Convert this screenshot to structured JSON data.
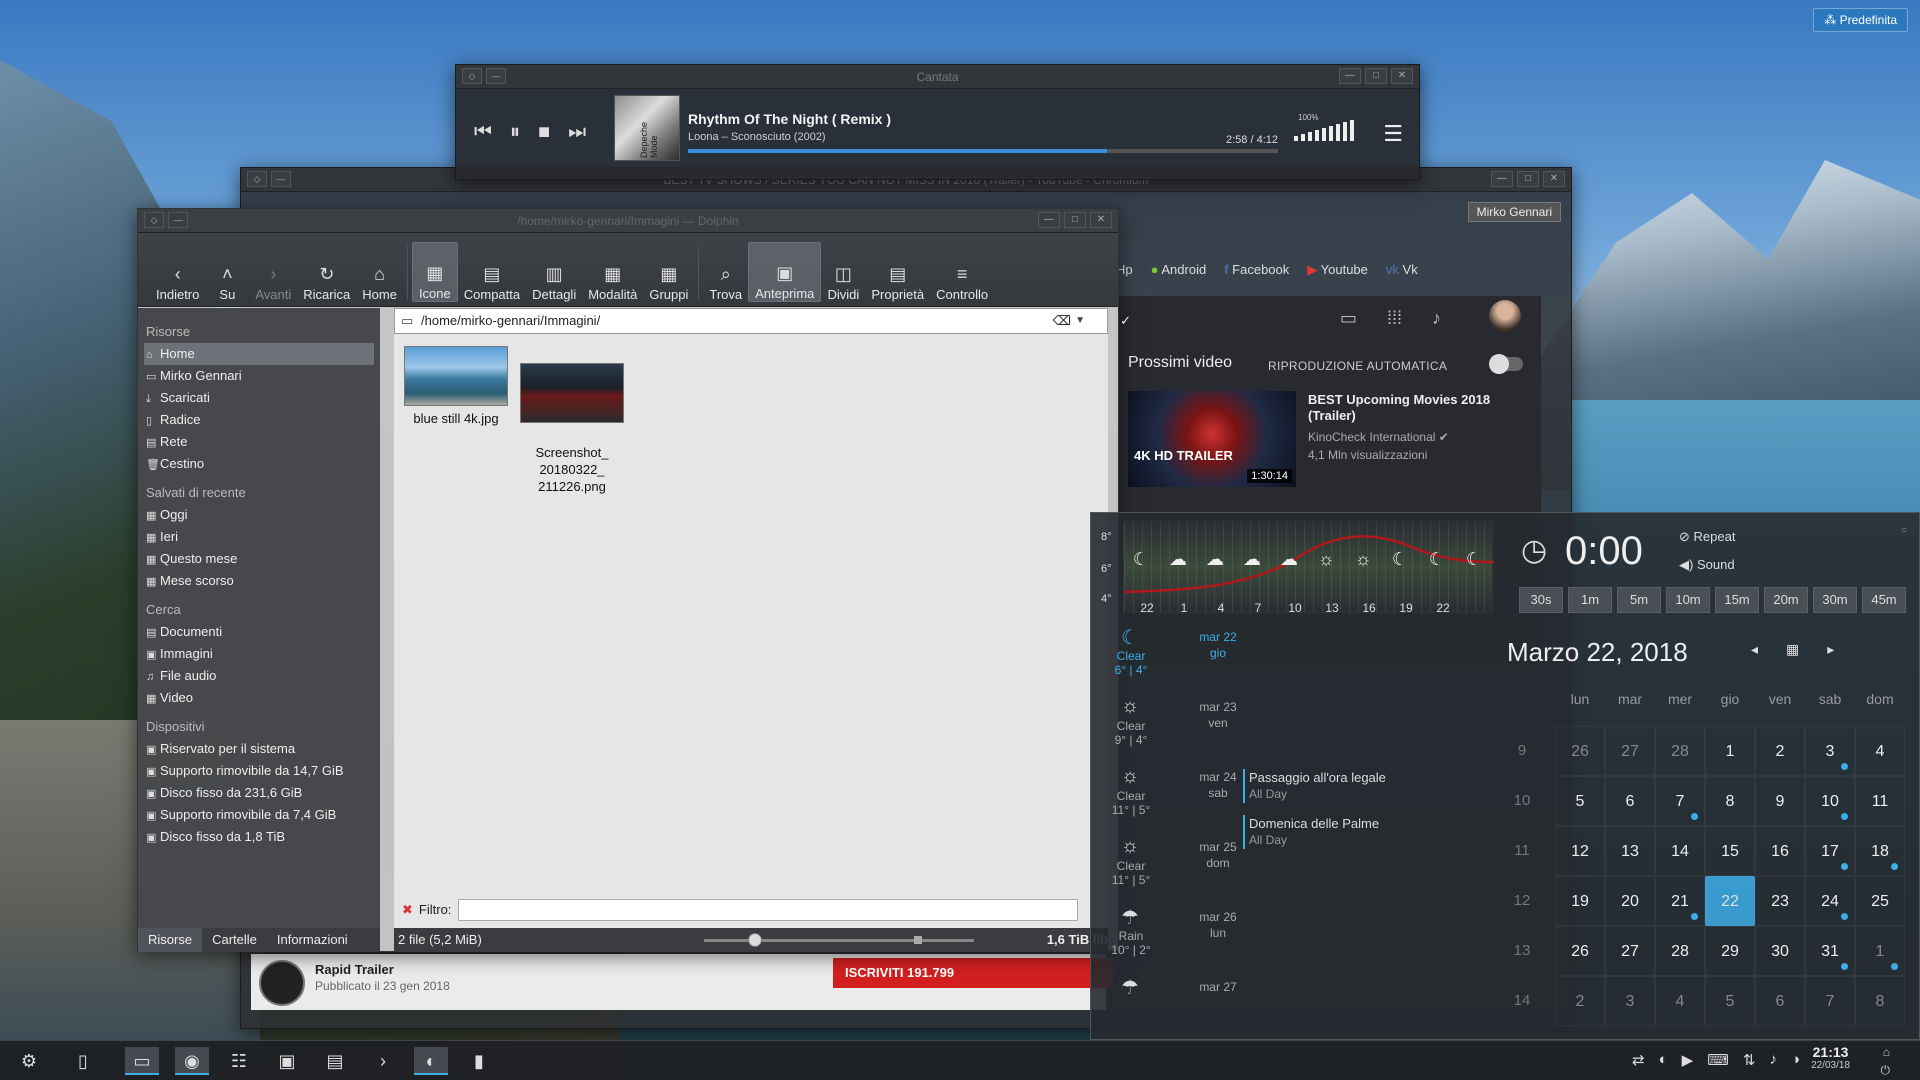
{
  "desktop": {
    "activity_label": "Predefinita"
  },
  "cantata": {
    "title": "Cantata",
    "track_title": "Rhythm Of The Night  ( Remix )",
    "track_subtitle": "Loona – Sconosciuto (2002)",
    "cover_text": "Depeche Mode",
    "time": "2:58 / 4:12",
    "progress": 0.71,
    "volume_label": "100%",
    "controls": [
      "⏮",
      "⏸",
      "■",
      "⏭"
    ]
  },
  "chromium": {
    "title": "BEST TV SHOWS / SERIES YOU CAN NOT MISS IN 2018 (Trailer) - YouTube - Chromium",
    "user": "Mirko Gennari",
    "bookmarks": [
      "Hp",
      "Android",
      "Facebook",
      "Youtube",
      "Vk"
    ],
    "up_next_label": "Prossimi video",
    "autoplay_label": "RIPRODUZIONE AUTOMATICA",
    "video": {
      "title": "BEST Upcoming Movies 2018 (Trailer)",
      "channel": "KinoCheck International ✔",
      "views": "4,1 Mln visualizzazioni",
      "duration": "1:30:14",
      "badge": "4K HD TRAILER"
    },
    "channel_name": "Rapid Trailer",
    "channel_published": "Pubblicato il 23 gen 2018",
    "subscribe_label": "ISCRIVITI  191.799"
  },
  "dolphin": {
    "title": "/home/mirko-gennari/Immagini — Dolphin",
    "toolbar": [
      {
        "label": "Indietro",
        "icon": "‹",
        "dim": false,
        "active": false
      },
      {
        "label": "Su",
        "icon": "˄",
        "dim": false,
        "active": false
      },
      {
        "label": "Avanti",
        "icon": "›",
        "dim": true,
        "active": false
      },
      {
        "label": "Ricarica",
        "icon": "↻",
        "dim": false,
        "active": false
      },
      {
        "label": "Home",
        "icon": "⌂",
        "dim": false,
        "active": false
      },
      {
        "label": "Icone",
        "icon": "▦",
        "dim": false,
        "active": true
      },
      {
        "label": "Compatta",
        "icon": "▤",
        "dim": false,
        "active": false
      },
      {
        "label": "Dettagli",
        "icon": "▥",
        "dim": false,
        "active": false
      },
      {
        "label": "Modalità",
        "icon": "▦",
        "dim": false,
        "active": false
      },
      {
        "label": "Gruppi",
        "icon": "▦",
        "dim": false,
        "active": false
      },
      {
        "label": "Trova",
        "icon": "⌕",
        "dim": false,
        "active": false
      },
      {
        "label": "Anteprima",
        "icon": "▣",
        "dim": false,
        "active": true
      },
      {
        "label": "Dividi",
        "icon": "◫",
        "dim": false,
        "active": false
      },
      {
        "label": "Proprietà",
        "icon": "▤",
        "dim": false,
        "active": false
      },
      {
        "label": "Controllo",
        "icon": "≡",
        "dim": false,
        "active": false
      }
    ],
    "sidebar": {
      "groups": [
        {
          "title": "Risorse",
          "items": [
            {
              "label": "Home",
              "icon": "⌂",
              "selected": true
            },
            {
              "label": "Mirko Gennari",
              "icon": "▭"
            },
            {
              "label": "Scaricati",
              "icon": "⤓"
            },
            {
              "label": "Radice",
              "icon": "▯"
            },
            {
              "label": "Rete",
              "icon": "▤"
            },
            {
              "label": "Cestino",
              "icon": "🗑"
            }
          ]
        },
        {
          "title": "Salvati di recente",
          "items": [
            {
              "label": "Oggi",
              "icon": "▦"
            },
            {
              "label": "Ieri",
              "icon": "▦"
            },
            {
              "label": "Questo mese",
              "icon": "▦"
            },
            {
              "label": "Mese scorso",
              "icon": "▦"
            }
          ]
        },
        {
          "title": "Cerca",
          "items": [
            {
              "label": "Documenti",
              "icon": "▤"
            },
            {
              "label": "Immagini",
              "icon": "▣"
            },
            {
              "label": "File audio",
              "icon": "♫"
            },
            {
              "label": "Video",
              "icon": "▦"
            }
          ]
        },
        {
          "title": "Dispositivi",
          "items": [
            {
              "label": "Riservato per il sistema",
              "icon": "▣",
              "color": "orange"
            },
            {
              "label": "Supporto rimovibile da 14,7 GiB",
              "icon": "▣",
              "color": "green"
            },
            {
              "label": "Disco fisso da 231,6 GiB",
              "icon": "▣",
              "color": "orange"
            },
            {
              "label": "Supporto rimovibile da 7,4 GiB",
              "icon": "▣",
              "color": "orange"
            },
            {
              "label": "Disco fisso da 1,8 TiB",
              "icon": "▣",
              "color": "green"
            }
          ]
        }
      ],
      "tabs": [
        "Risorse",
        "Cartelle",
        "Informazioni"
      ]
    },
    "path": "/home/mirko-gennari/Immagini/",
    "files": [
      {
        "name": "blue still 4k.jpg"
      },
      {
        "name": "Screenshot_\n20180322_\n211226.png"
      }
    ],
    "filter_label": "Filtro:",
    "status": "2 file (5,2 MiB)",
    "free_space": "1,6 TiB lib"
  },
  "weather": {
    "temp_labels": [
      "8°",
      "6°",
      "4°"
    ],
    "hours": [
      "22",
      "1",
      "4",
      "7",
      "10",
      "13",
      "16",
      "19",
      "22"
    ],
    "hour_icons": [
      "☾",
      "☁",
      "☁",
      "☁",
      "☁",
      "☼",
      "☼",
      "☾",
      "☾",
      "☾"
    ],
    "days": [
      {
        "icon": "☾",
        "desc": "Clear",
        "temps": "6° | 4°",
        "date": "mar 22",
        "weekday": "gio",
        "current": true
      },
      {
        "icon": "☼",
        "desc": "Clear",
        "temps": "9° | 4°",
        "date": "mar 23",
        "weekday": "ven"
      },
      {
        "icon": "☼",
        "desc": "Clear",
        "temps": "11° | 5°",
        "date": "mar 24",
        "weekday": "sab"
      },
      {
        "icon": "☼",
        "desc": "Clear",
        "temps": "11° | 5°",
        "date": "mar 25",
        "weekday": "dom"
      },
      {
        "icon": "☂",
        "desc": "Rain",
        "temps": "10° | 2°",
        "date": "mar 26",
        "weekday": "lun"
      },
      {
        "icon": "☂",
        "desc": "",
        "temps": "",
        "date": "mar 27",
        "weekday": ""
      }
    ],
    "events": [
      {
        "title": "Passaggio all'ora legale",
        "sub": "All Day"
      },
      {
        "title": "Domenica delle Palme",
        "sub": "All Day"
      }
    ]
  },
  "timer": {
    "value": "0:00",
    "repeat_label": "Repeat",
    "sound_label": "Sound",
    "presets": [
      "30s",
      "1m",
      "5m",
      "10m",
      "15m",
      "20m",
      "30m",
      "45m"
    ]
  },
  "calendar": {
    "title": "Marzo 22, 2018",
    "weekdays": [
      "lun",
      "mar",
      "mer",
      "gio",
      "ven",
      "sab",
      "dom"
    ],
    "weeks": [
      "9",
      "10",
      "11",
      "12",
      "13",
      "14"
    ],
    "days": [
      {
        "d": "26",
        "o": true
      },
      {
        "d": "27",
        "o": true
      },
      {
        "d": "28",
        "o": true
      },
      {
        "d": "1"
      },
      {
        "d": "2"
      },
      {
        "d": "3",
        "e": true
      },
      {
        "d": "4"
      },
      {
        "d": "5"
      },
      {
        "d": "6"
      },
      {
        "d": "7",
        "e": true
      },
      {
        "d": "8"
      },
      {
        "d": "9"
      },
      {
        "d": "10",
        "e": true
      },
      {
        "d": "11"
      },
      {
        "d": "12"
      },
      {
        "d": "13"
      },
      {
        "d": "14"
      },
      {
        "d": "15"
      },
      {
        "d": "16"
      },
      {
        "d": "17",
        "e": true
      },
      {
        "d": "18",
        "e": true
      },
      {
        "d": "19"
      },
      {
        "d": "20"
      },
      {
        "d": "21",
        "e": true
      },
      {
        "d": "22",
        "t": true
      },
      {
        "d": "23"
      },
      {
        "d": "24",
        "e": true
      },
      {
        "d": "25"
      },
      {
        "d": "26"
      },
      {
        "d": "27"
      },
      {
        "d": "28"
      },
      {
        "d": "29"
      },
      {
        "d": "30"
      },
      {
        "d": "31",
        "e": true
      },
      {
        "d": "1",
        "o": true,
        "e": true
      },
      {
        "d": "2",
        "o": true
      },
      {
        "d": "3",
        "o": true
      },
      {
        "d": "4",
        "o": true
      },
      {
        "d": "5",
        "o": true
      },
      {
        "d": "6",
        "o": true
      },
      {
        "d": "7",
        "o": true
      },
      {
        "d": "8",
        "o": true
      }
    ]
  },
  "taskbar": {
    "clock_time": "21:13",
    "clock_date": "22/03/18",
    "tray_icons": [
      "⇄",
      "◐",
      "▶",
      "⌨",
      "⇅",
      "♪",
      "◑"
    ]
  },
  "colors": {
    "accent": "#3daee9",
    "subscribe": "#d21f1f"
  }
}
